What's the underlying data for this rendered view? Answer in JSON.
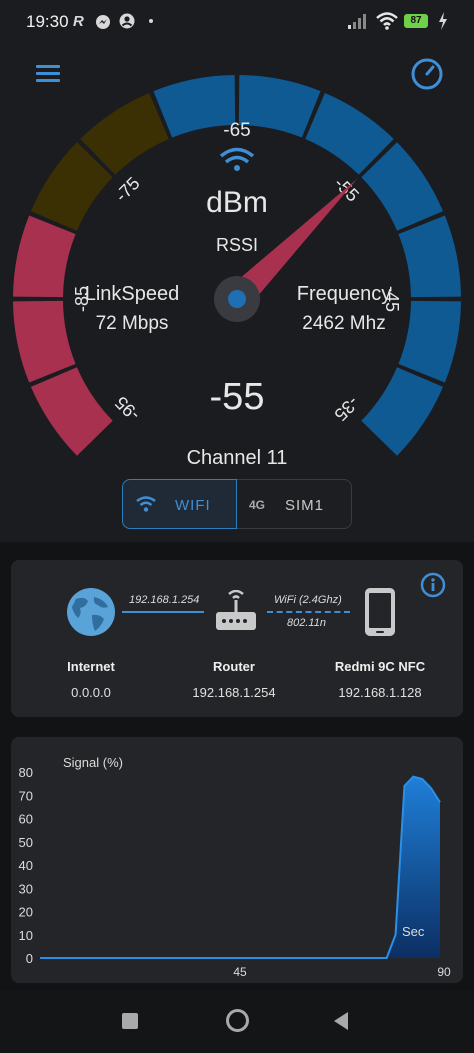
{
  "status_bar": {
    "time": "19:30",
    "left_icons": [
      "r-icon",
      "messenger-icon",
      "account-icon",
      "dot-icon"
    ],
    "right_icons": [
      "signal-icon",
      "wifi-icon",
      "battery-icon",
      "charging-icon"
    ],
    "battery": "87"
  },
  "toolbar": {
    "menu_icon": "hamburger-menu-icon",
    "speed_icon": "speedometer-icon"
  },
  "gauge": {
    "rssi_top": "-65",
    "unit": "dBm",
    "rssi_label": "RSSI",
    "value": "-55",
    "link_speed_label": "LinkSpeed",
    "link_speed_value": "72 Mbps",
    "frequency_label": "Frequency",
    "frequency_value": "2462 Mhz",
    "channel": "Channel 11",
    "scale_labels": [
      "-95",
      "-85",
      "-75",
      "-65",
      "-55",
      "-45",
      "-35"
    ],
    "needle_value": -55,
    "colors": {
      "red": "#a8314f",
      "brown": "#3b3004",
      "blue": "#0f5a93",
      "needle": "#a8314f",
      "accent": "#3e8fd6"
    }
  },
  "tabs": {
    "wifi": "WIFI",
    "sim_4g": "4G",
    "sim": "SIM1"
  },
  "network": {
    "link1_label": "192.168.1.254",
    "link2_label": "WiFi (2.4Ghz)",
    "link2_sublabel": "802.11n",
    "nodes": [
      {
        "name": "Internet",
        "ip": "0.0.0.0"
      },
      {
        "name": "Router",
        "ip": "192.168.1.254"
      },
      {
        "name": "Redmi 9C NFC",
        "ip": "192.168.1.128"
      }
    ]
  },
  "chart_data": {
    "type": "area",
    "title": "Signal (%)",
    "xlabel": "Sec",
    "ylabel": "",
    "y_ticks": [
      "80",
      "70",
      "60",
      "50",
      "40",
      "30",
      "20",
      "10",
      "0"
    ],
    "x_ticks": [
      "45",
      "90"
    ],
    "ylim": [
      0,
      80
    ],
    "xlim": [
      0,
      90
    ],
    "series": [
      {
        "x": [
          0,
          78,
          80,
          82,
          84,
          86,
          88,
          90
        ],
        "values": [
          0,
          0,
          10,
          74,
          78,
          77,
          73,
          67
        ]
      }
    ]
  }
}
